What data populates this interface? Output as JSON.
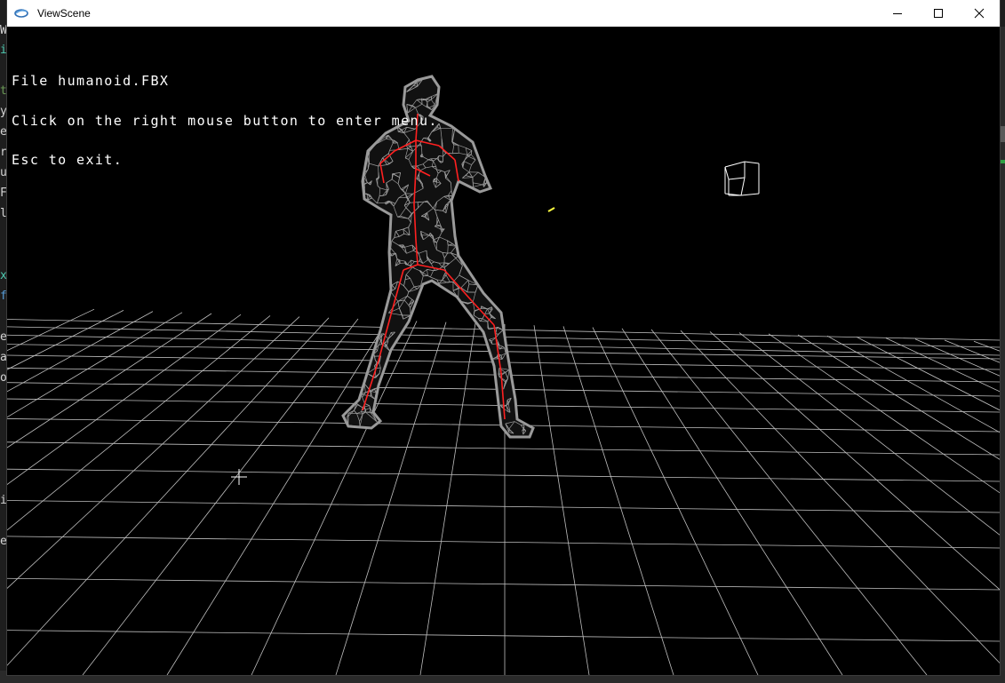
{
  "window": {
    "title": "ViewScene"
  },
  "viewport": {
    "overlay_lines": [
      "File humanoid.FBX",
      "Click on the right mouse button to enter menu.",
      "Esc to exit."
    ],
    "model": "humanoid wireframe with skeleton",
    "colors": {
      "background": "#000000",
      "grid": "#bfbfbf",
      "mesh": "#9a9a9a",
      "skeleton": "#ff2020",
      "camera_gizmo": "#ffffff",
      "light_marker": "#ffff40"
    }
  },
  "background_editor": {
    "chars": [
      "W",
      "i",
      "t",
      "y",
      "e",
      "r",
      "u",
      "F",
      "l",
      "x",
      "f",
      "e",
      "a",
      "o",
      "i",
      "e"
    ],
    "colors": [
      "#d4d4d4",
      "#4ec9b0",
      "#6a9955",
      "#d4d4d4",
      "#d4d4d4",
      "#d4d4d4",
      "#d4d4d4",
      "#d4d4d4",
      "#d4d4d4",
      "#4ec9b0",
      "#569cd6",
      "#d4d4d4",
      "#d4d4d4",
      "#d4d4d4",
      "#d4d4d4",
      "#d4d4d4"
    ]
  }
}
